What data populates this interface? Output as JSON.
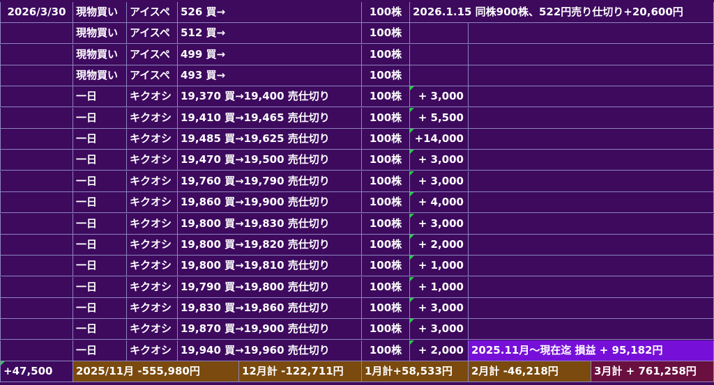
{
  "rows": [
    {
      "date": "2026/3/30",
      "type": "現物買い",
      "name": "アイスペ",
      "trade": "526 買→",
      "qty": "100株",
      "profit": "",
      "note": "2026.1.15 同株900株、522円売り仕切り+20,600円"
    },
    {
      "date": "",
      "type": "現物買い",
      "name": "アイスペ",
      "trade": "512 買→",
      "qty": "100株",
      "profit": "",
      "note": ""
    },
    {
      "date": "",
      "type": "現物買い",
      "name": "アイスペ",
      "trade": "499 買→",
      "qty": "100株",
      "profit": "",
      "note": ""
    },
    {
      "date": "",
      "type": "現物買い",
      "name": "アイスペ",
      "trade": "493 買→",
      "qty": "100株",
      "profit": "",
      "note": ""
    },
    {
      "date": "",
      "type": "一日",
      "name": "キクオシ",
      "trade": "19,370 買→19,400 売仕切り",
      "qty": "100株",
      "profit": "+  3,000",
      "note": ""
    },
    {
      "date": "",
      "type": "一日",
      "name": "キクオシ",
      "trade": "19,410 買→19,465 売仕切り",
      "qty": "100株",
      "profit": "+  5,500",
      "note": ""
    },
    {
      "date": "",
      "type": "一日",
      "name": "キクオシ",
      "trade": "19,485 買→19,625 売仕切り",
      "qty": "100株",
      "profit": "+14,000",
      "note": ""
    },
    {
      "date": "",
      "type": "一日",
      "name": "キクオシ",
      "trade": "19,470 買→19,500 売仕切り",
      "qty": "100株",
      "profit": "+  3,000",
      "note": ""
    },
    {
      "date": "",
      "type": "一日",
      "name": "キクオシ",
      "trade": "19,760 買→19,790 売仕切り",
      "qty": "100株",
      "profit": "+  3,000",
      "note": ""
    },
    {
      "date": "",
      "type": "一日",
      "name": "キクオシ",
      "trade": "19,860 買→19,900 売仕切り",
      "qty": "100株",
      "profit": "+  4,000",
      "note": ""
    },
    {
      "date": "",
      "type": "一日",
      "name": "キクオシ",
      "trade": "19,800 買→19,830 売仕切り",
      "qty": "100株",
      "profit": "+  3,000",
      "note": ""
    },
    {
      "date": "",
      "type": "一日",
      "name": "キクオシ",
      "trade": "19,800 買→19,820 売仕切り",
      "qty": "100株",
      "profit": "+  2,000",
      "note": ""
    },
    {
      "date": "",
      "type": "一日",
      "name": "キクオシ",
      "trade": "19,800 買→19,810 売仕切り",
      "qty": "100株",
      "profit": "+  1,000",
      "note": ""
    },
    {
      "date": "",
      "type": "一日",
      "name": "キクオシ",
      "trade": "19,790 買→19,800 売仕切り",
      "qty": "100株",
      "profit": "+  1,000",
      "note": ""
    },
    {
      "date": "",
      "type": "一日",
      "name": "キクオシ",
      "trade": "19,830 買→19,860 売仕切り",
      "qty": "100株",
      "profit": "+  3,000",
      "note": ""
    },
    {
      "date": "",
      "type": "一日",
      "name": "キクオシ",
      "trade": "19,870 買→19,900 売仕切り",
      "qty": "100株",
      "profit": "+  3,000",
      "note": ""
    },
    {
      "date": "",
      "type": "一日",
      "name": "キクオシ",
      "trade": "19,940 買→19,960 売仕切り",
      "qty": "100株",
      "profit": "+  2,000",
      "note": "2025.11月～現在迄 損益 + 95,182円"
    }
  ],
  "summary": {
    "total": "+47,500",
    "nov": "2025/11月   -555,980円",
    "dec": "12月計 -122,711円",
    "jan": "1月計+58,533円",
    "feb": "2月計 -46,218円",
    "mar": "3月計 + 761,258円"
  },
  "colors": {
    "bg": "#3d0a5e",
    "grid": "#8f86c0",
    "highlight": "#7610d8",
    "summary_bg": "#7a4a0e",
    "march_bg": "#6a1040",
    "marker": "#22cc44"
  }
}
